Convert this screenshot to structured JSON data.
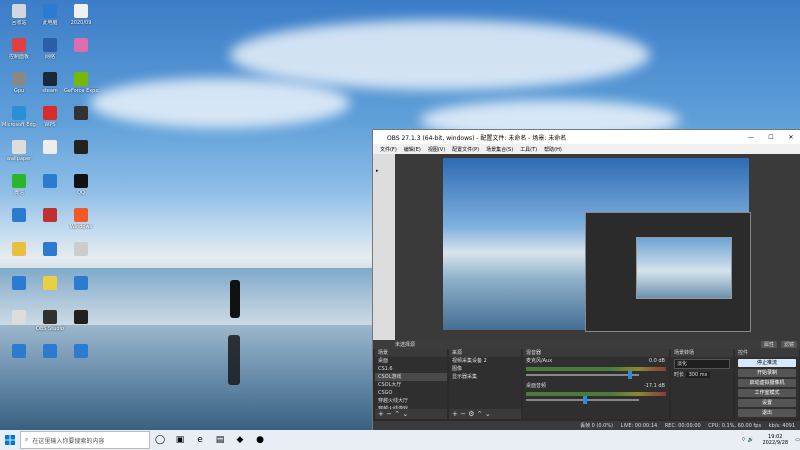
{
  "desktop": {
    "icons": [
      {
        "label": "回收站",
        "color": "#cfd8e0"
      },
      {
        "label": "此电脑",
        "color": "#2b7bd0"
      },
      {
        "label": "2020/09",
        "color": "#f0f0f0"
      },
      {
        "label": "控制面板",
        "color": "#e04040"
      },
      {
        "label": "网络",
        "color": "#2b5ea8"
      },
      {
        "label": "",
        "color": "#e06cb0"
      },
      {
        "label": "Gpu",
        "color": "#888888"
      },
      {
        "label": "steam",
        "color": "#1b2838"
      },
      {
        "label": "GeForce Experience",
        "color": "#76b900"
      },
      {
        "label": "Microsoft Edge",
        "color": "#2b8fd6"
      },
      {
        "label": "WPS",
        "color": "#d82b2b"
      },
      {
        "label": "",
        "color": "#333333"
      },
      {
        "label": "wallpaper",
        "color": "#ddd"
      },
      {
        "label": "",
        "color": "#eee"
      },
      {
        "label": "",
        "color": "#222"
      },
      {
        "label": "微信",
        "color": "#2bb52b"
      },
      {
        "label": "",
        "color": "#2b7bd0"
      },
      {
        "label": "QQ",
        "color": "#111"
      },
      {
        "label": "",
        "color": "#2b7bd0"
      },
      {
        "label": "",
        "color": "#c03030"
      },
      {
        "label": "Windows",
        "color": "#f05a28"
      },
      {
        "label": "",
        "color": "#e8c040"
      },
      {
        "label": "",
        "color": "#2b7bd0"
      },
      {
        "label": "",
        "color": "#ccc"
      },
      {
        "label": "",
        "color": "#2b7bd0"
      },
      {
        "label": "",
        "color": "#e8d040"
      },
      {
        "label": "",
        "color": "#2b7bd0"
      },
      {
        "label": "",
        "color": "#ddd"
      },
      {
        "label": "OBS Studio",
        "color": "#303030"
      },
      {
        "label": "",
        "color": "#202020"
      },
      {
        "label": "",
        "color": "#2b7bd0"
      },
      {
        "label": "",
        "color": "#2b7bd0"
      },
      {
        "label": "",
        "color": "#2b7bd0"
      }
    ]
  },
  "obs": {
    "title": "OBS 27.1.3 (64-bit, windows) - 配置文件: 未命名 - 场景: 未命名",
    "menu": [
      "文件(F)",
      "编辑(E)",
      "视图(V)",
      "配置文件(P)",
      "场景集合(S)",
      "工具(T)",
      "帮助(H)"
    ],
    "scene_bar": {
      "name": "未选择源",
      "properties": "属性",
      "filters": "滤镜"
    },
    "scenes": {
      "title": "场景",
      "items": [
        "桌面",
        "CS1.6",
        "CSOL游戏",
        "CSOL大厅",
        "CSGO",
        "穿越火线大厅",
        "穿越火线游戏"
      ],
      "selected_index": 2
    },
    "sources": {
      "title": "来源",
      "items": [
        "视频采集设备 2",
        "图像",
        "显示器采集"
      ]
    },
    "mixer": {
      "title": "混音器",
      "tracks": [
        {
          "name": "麦克风/Aux",
          "db": "0.0 dB"
        },
        {
          "name": "桌面音频",
          "db": "-17.1 dB"
        }
      ]
    },
    "transitions": {
      "title": "场景转场",
      "type": "淡化",
      "duration_label": "时长",
      "duration_value": "300 ms"
    },
    "controls": {
      "title": "控件",
      "buttons": [
        "停止推流",
        "开始录制",
        "启动虚拟摄像机",
        "工作室模式",
        "设置",
        "退出"
      ]
    },
    "status": {
      "dropped": "丢帧 0 (0.0%)",
      "live": "LIVE: 00:00:14",
      "rec": "REC: 00:00:00",
      "cpu": "CPU: 0.1%, 60.00 fps",
      "kbps": "kb/s: 4091"
    }
  },
  "taskbar": {
    "search_placeholder": "在这里输入你要搜索的内容",
    "time": "19:02",
    "date": "2022/9/28",
    "pinned": [
      "◯",
      "▣",
      "e",
      "▤",
      "◆",
      "●"
    ]
  }
}
